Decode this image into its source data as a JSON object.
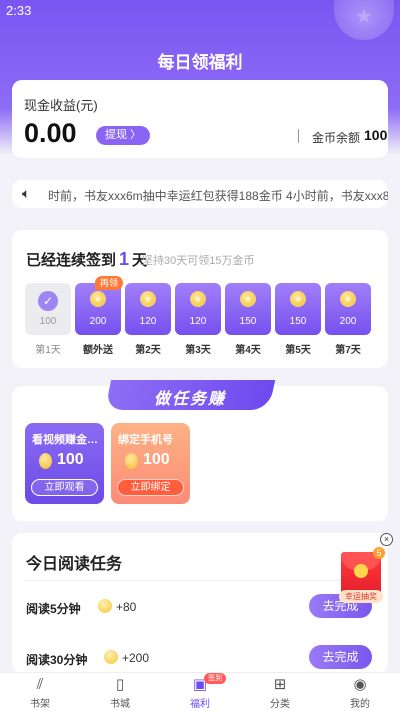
{
  "status_bar": {
    "time": "2:33"
  },
  "header": {
    "title": "每日领福利"
  },
  "cash": {
    "label": "现金收益(元)",
    "amount": "0.00",
    "withdraw_label": "提现 〉",
    "coin_label": "金币余额",
    "coin_value": "100"
  },
  "marquee": {
    "text": "时前，书友xxx6m抽中幸运红包获得188金币  4小时前，书友xxx8"
  },
  "signin": {
    "title_prefix": "已经连续签到",
    "days": "1",
    "title_suffix": "天",
    "subtitle": "坚持30天可领15万金币",
    "again_badge": "再领",
    "items": [
      {
        "value": "100",
        "label": "第1天",
        "done": true
      },
      {
        "value": "200",
        "label": "额外送",
        "done": false
      },
      {
        "value": "120",
        "label": "第2天",
        "done": false
      },
      {
        "value": "120",
        "label": "第3天",
        "done": false
      },
      {
        "value": "150",
        "label": "第4天",
        "done": false
      },
      {
        "value": "150",
        "label": "第5天",
        "done": false
      },
      {
        "value": "200",
        "label": "第7天",
        "done": false
      }
    ]
  },
  "tasks": {
    "banner": "做任务赚",
    "tiles": [
      {
        "title": "看视频赚金…",
        "amount": "100",
        "button": "立即观看"
      },
      {
        "title": "绑定手机号",
        "amount": "100",
        "button": "立即绑定"
      }
    ]
  },
  "reading": {
    "title": "今日阅读任务",
    "rows": [
      {
        "label": "阅读5分钟",
        "reward": "+80",
        "button": "去完成"
      },
      {
        "label": "阅读30分钟",
        "reward": "+200",
        "button": "去完成"
      }
    ]
  },
  "float_widget": {
    "count": "5",
    "label": "幸运抽奖",
    "close": "×"
  },
  "tabbar": {
    "items": [
      {
        "label": "书架",
        "icon": "bookshelf-icon"
      },
      {
        "label": "书城",
        "icon": "book-icon"
      },
      {
        "label": "福利",
        "icon": "calendar-gift-icon",
        "badge": "签到"
      },
      {
        "label": "分类",
        "icon": "grid-icon"
      },
      {
        "label": "我的",
        "icon": "profile-icon"
      }
    ]
  },
  "colors": {
    "primary": "#7b55f2",
    "accent": "#ff5d3c"
  }
}
